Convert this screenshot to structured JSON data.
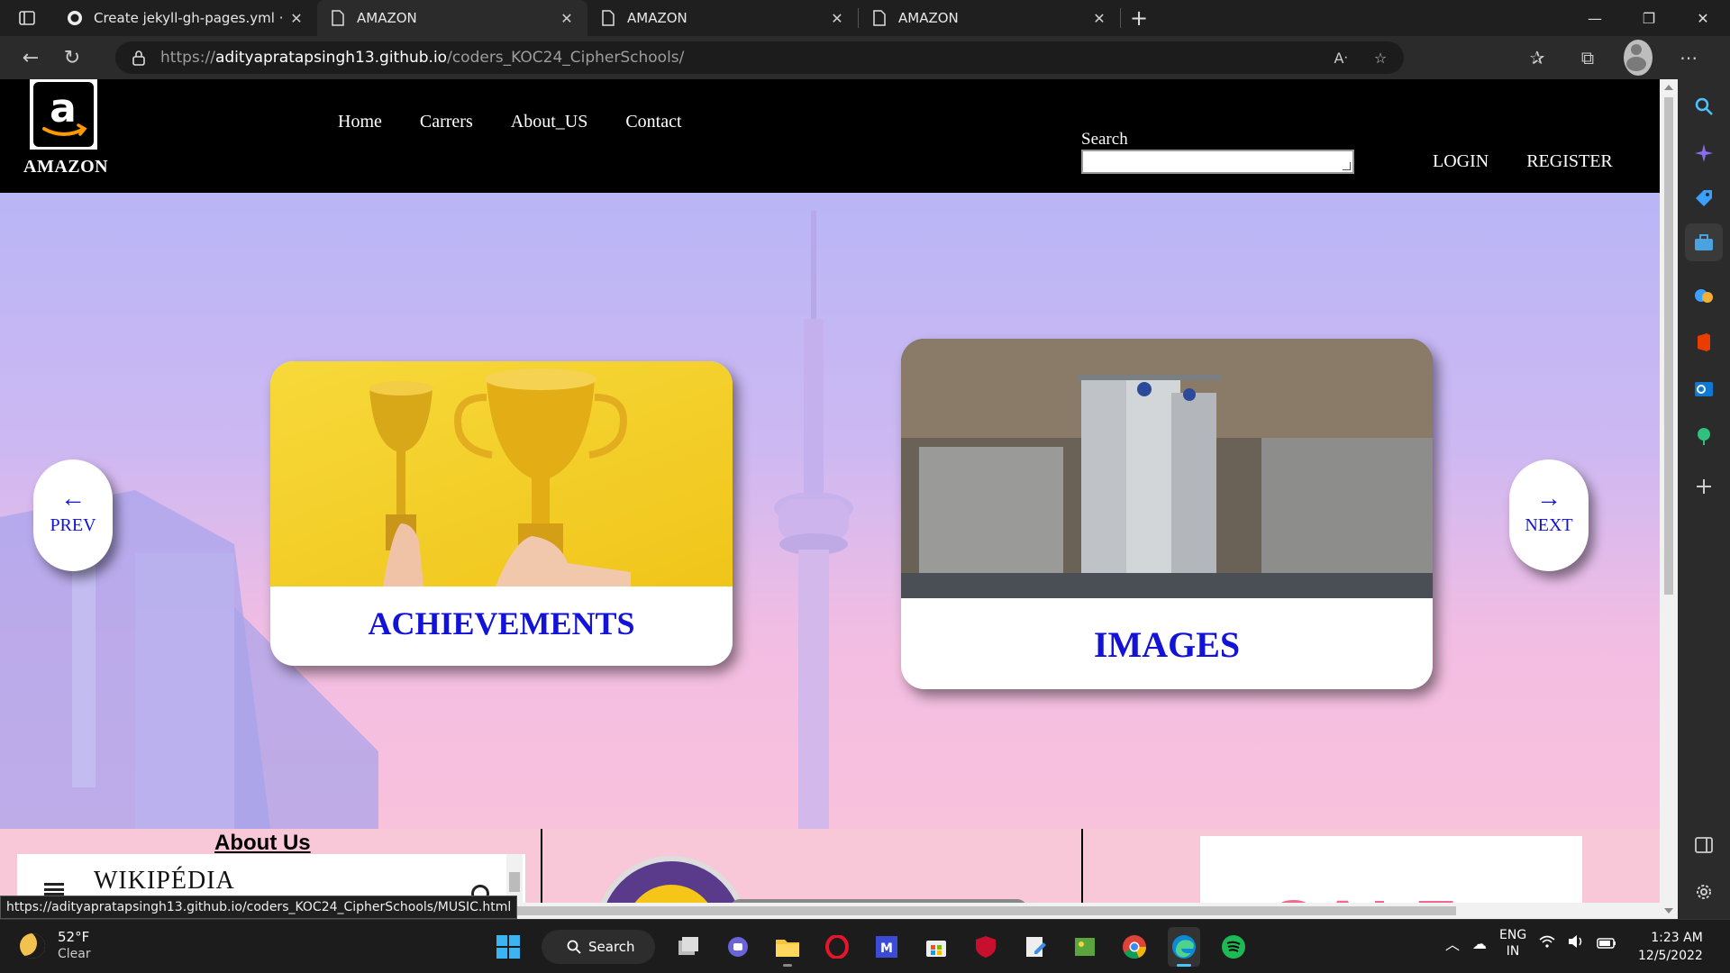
{
  "browser": {
    "tabs": [
      {
        "title": "Create jekyll-gh-pages.yml · adity",
        "icon": "github-icon",
        "active": false
      },
      {
        "title": "AMAZON",
        "icon": "page-icon",
        "active": true
      },
      {
        "title": "AMAZON",
        "icon": "page-icon",
        "active": false
      },
      {
        "title": "AMAZON",
        "icon": "page-icon",
        "active": false
      }
    ],
    "url_scheme": "https://",
    "url_host": "adityapratapsingh13.github.io",
    "url_path": "/coders_KOC24_CipherSchools/",
    "status_url": "https://adityapratapsingh13.github.io/coders_KOC24_CipherSchools/MUSIC.html"
  },
  "site": {
    "brand": "AMAZON",
    "nav": [
      "Home",
      "Carrers",
      "About_US",
      "Contact"
    ],
    "search_label": "Search",
    "login": "LOGIN",
    "register": "REGISTER",
    "cards": {
      "achievements": "ACHIEVEMENTS",
      "images": "IMAGES"
    },
    "prev_arrow": "←",
    "prev_label": "PREV",
    "next_arrow": "→",
    "next_label": "NEXT",
    "about_title": "About Us",
    "wiki_word": "WIKIPÉDIA",
    "sale_text": "SALE"
  },
  "taskbar": {
    "weather_temp": "52°F",
    "weather_desc": "Clear",
    "search_label": "Search",
    "lang_primary": "ENG",
    "lang_secondary": "IN",
    "time": "1:23 AM",
    "date": "12/5/2022"
  },
  "colors": {
    "card_title": "#1212d8",
    "header_bg": "#000000",
    "accent_edge": "#4cc2ff"
  }
}
